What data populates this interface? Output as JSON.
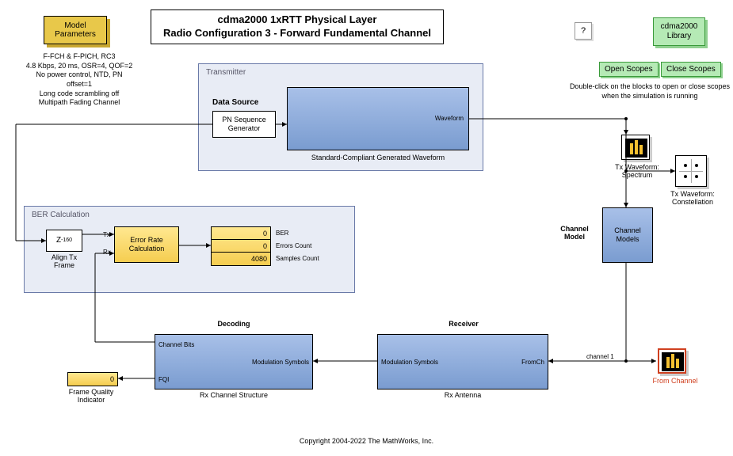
{
  "title": {
    "line1": "cdma2000 1xRTT Physical Layer",
    "line2": "Radio Configuration 3 - Forward Fundamental Channel"
  },
  "model_params": {
    "label": "Model\nParameters",
    "lines": [
      "F-FCH & F-PICH, RC3",
      "4.8 Kbps, 20 ms, OSR=4, QOF=2",
      "No power control, NTD, PN offset=1",
      "Long code scrambling off",
      "Multipath Fading Channel"
    ]
  },
  "help": "?",
  "library_btn": "cdma2000\nLibrary",
  "open_scopes": "Open Scopes",
  "close_scopes": "Close Scopes",
  "scopes_hint": "Double-click on the blocks to open or close scopes\nwhen the simulation is running",
  "transmitter": {
    "frame_title": "Transmitter",
    "data_source_title": "Data Source",
    "pn_block": "PN Sequence\nGenerator",
    "waveform_port": "Waveform",
    "waveform_label": "Standard-Compliant Generated Waveform"
  },
  "ber": {
    "frame_title": "BER Calculation",
    "align_block": "Z",
    "align_exp": "-160",
    "align_label": "Align Tx\nFrame",
    "erc_tx": "Tx",
    "erc_rx": "Rx",
    "erc_block": "Error Rate\nCalculation",
    "display": {
      "ber": "0",
      "errors": "0",
      "samples": "4080"
    },
    "display_labels": {
      "ber": "BER",
      "errors": "Errors Count",
      "samples": "Samples Count"
    }
  },
  "channel_model": {
    "title": "Channel\nModel",
    "block": "Channel\nModels"
  },
  "decoding": {
    "title": "Decoding",
    "channel_bits": "Channel Bits",
    "mod_symbols": "Modulation Symbols",
    "fqi": "FQI",
    "label": "Rx Channel Structure"
  },
  "receiver": {
    "title": "Receiver",
    "mod_symbols": "Modulation Symbols",
    "from_ch": "FromCh",
    "label": "Rx Antenna",
    "channel_port": "channel 1"
  },
  "fqi": {
    "value": "0",
    "label": "Frame Quality\nIndicator"
  },
  "scopes": {
    "tx_spectrum": "Tx Waveform:\nSpectrum",
    "tx_constellation": "Tx Waveform:\nConstellation",
    "from_channel": "From Channel"
  },
  "copyright": "Copyright 2004-2022 The MathWorks, Inc."
}
